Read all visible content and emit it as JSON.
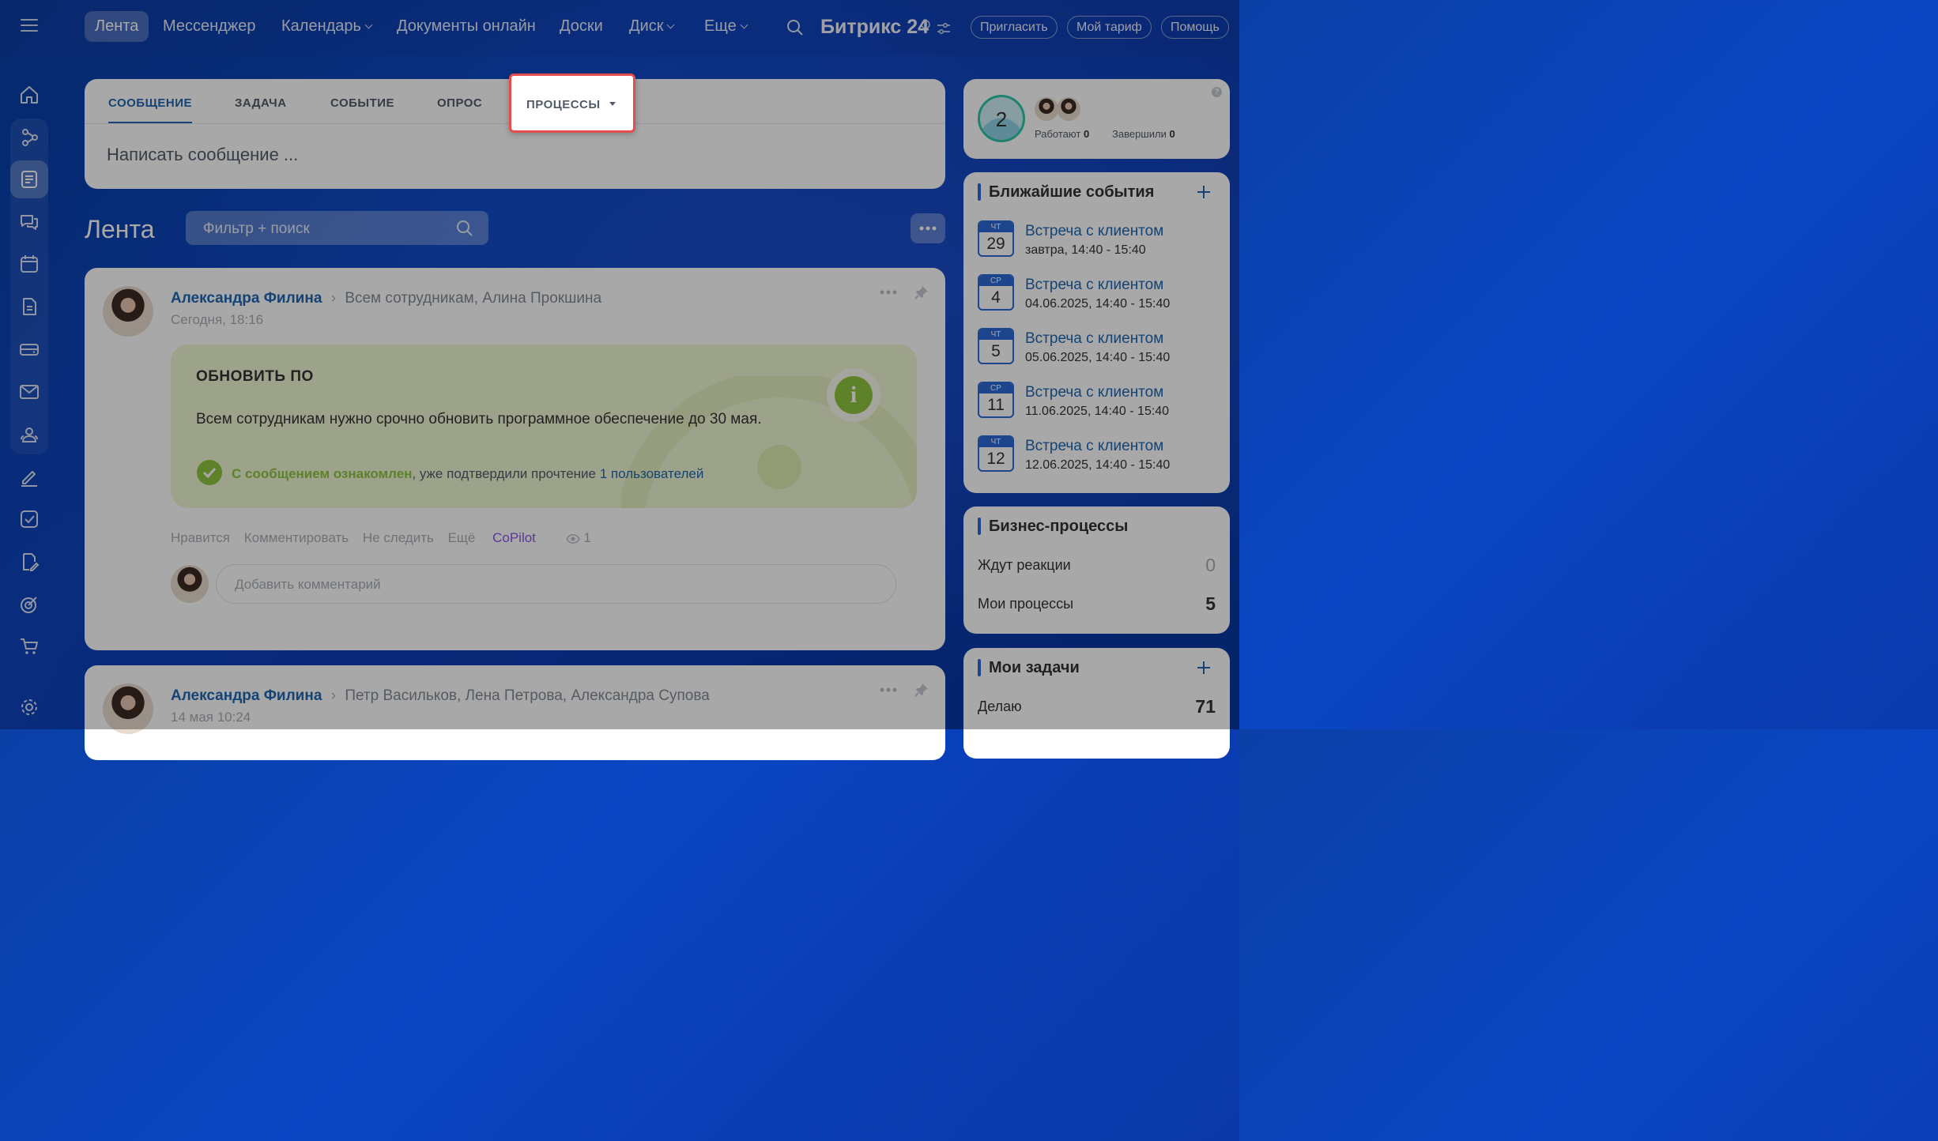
{
  "topnav": {
    "items": [
      "Лента",
      "Мессенджер",
      "Календарь",
      "Документы онлайн",
      "Доски",
      "Диск",
      "Еще"
    ],
    "brand": "Битрикс",
    "brand_num": "24",
    "invite": "Пригласить",
    "tariff": "Мой тариф",
    "help": "Помощь"
  },
  "composer": {
    "tabs": [
      "СООБЩЕНИЕ",
      "ЗАДАЧА",
      "СОБЫТИЕ",
      "ОПРОС",
      "ПРОЦЕССЫ"
    ],
    "placeholder": "Написать сообщение ..."
  },
  "feed": {
    "title": "Лента",
    "search_placeholder": "Фильтр + поиск"
  },
  "posts": [
    {
      "author": "Александра Филина",
      "recipients": "Всем сотрудникам, Алина Прокшина",
      "time": "Сегодня, 18:16",
      "heading": "ОБНОВИТЬ ПО",
      "text": "Всем сотрудникам нужно срочно обновить программное обеспечение до 30 мая.",
      "ack": "С сообщением ознакомлен",
      "ack_rest": ", уже подтвердили прочтение",
      "ack_link": "1 пользователей",
      "actions": [
        "Нравится",
        "Комментировать",
        "Не следить",
        "Ещё",
        "CoPilot"
      ],
      "views": "1",
      "comment_placeholder": "Добавить комментарий"
    },
    {
      "author": "Александра Филина",
      "recipients": "Петр Васильков, Лена Петрова, Александра Супова",
      "time": "14 мая 10:24"
    }
  ],
  "workday": {
    "count": "2",
    "working_label": "Работают",
    "working_value": "0",
    "finished_label": "Завершили",
    "finished_value": "0"
  },
  "events": {
    "title": "Ближайшие события",
    "items": [
      {
        "dow": "ЧТ",
        "day": "29",
        "title": "Встреча с клиентом",
        "time": "завтра, 14:40 - 15:40"
      },
      {
        "dow": "СР",
        "day": "4",
        "title": "Встреча с клиентом",
        "time": "04.06.2025, 14:40 - 15:40"
      },
      {
        "dow": "ЧТ",
        "day": "5",
        "title": "Встреча с клиентом",
        "time": "05.06.2025, 14:40 - 15:40"
      },
      {
        "dow": "СР",
        "day": "11",
        "title": "Встреча с клиентом",
        "time": "11.06.2025, 14:40 - 15:40"
      },
      {
        "dow": "ЧТ",
        "day": "12",
        "title": "Встреча с клиентом",
        "time": "12.06.2025, 14:40 - 15:40"
      }
    ]
  },
  "bp": {
    "title": "Бизнес-процессы",
    "waiting_label": "Ждут реакции",
    "waiting_value": "0",
    "mine_label": "Мои процессы",
    "mine_value": "5"
  },
  "tasks": {
    "title": "Мои задачи",
    "doing_label": "Делаю",
    "doing_value": "71"
  }
}
